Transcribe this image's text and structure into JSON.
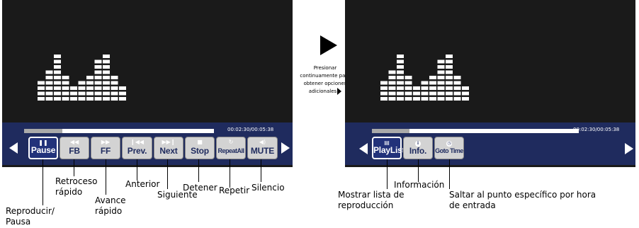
{
  "left_panel": {
    "time": "00:02:30/00:05:38",
    "progress": 0.2,
    "buttons": [
      {
        "label": "Pause",
        "icon": "pause-icon"
      },
      {
        "label": "FB",
        "icon": "fast-backward-icon"
      },
      {
        "label": "FF",
        "icon": "fast-forward-icon"
      },
      {
        "label": "Prev.",
        "icon": "previous-icon"
      },
      {
        "label": "Next",
        "icon": "next-icon"
      },
      {
        "label": "Stop",
        "icon": "stop-icon"
      },
      {
        "label": "RepeatAll",
        "icon": "repeat-icon"
      },
      {
        "label": "MUTE",
        "icon": "speaker-icon"
      }
    ]
  },
  "middle": {
    "instruction": "Presionar continuamente para obtener opciones adicionales"
  },
  "right_panel": {
    "time": "00:02:30/00:05:38",
    "progress": 0.18,
    "buttons": [
      {
        "label": "PlayList",
        "icon": "playlist-icon"
      },
      {
        "label": "Info.",
        "icon": "info-icon"
      },
      {
        "label": "Goto Time",
        "icon": "clock-icon"
      }
    ]
  },
  "callouts": {
    "reproducir_pausa": "Reproducir/ Pausa",
    "retroceso_rapido": "Retroceso rápido",
    "avance_rapido": "Avance rápido",
    "anterior": "Anterior",
    "siguiente": "Siguiente",
    "detener": "Detener",
    "repetir": "Repetir",
    "silencio": "Silencio",
    "mostrar_lista": "Mostrar lista de reproducción",
    "informacion": "Información",
    "saltar_punto": "Saltar al punto específico por hora de entrada"
  }
}
